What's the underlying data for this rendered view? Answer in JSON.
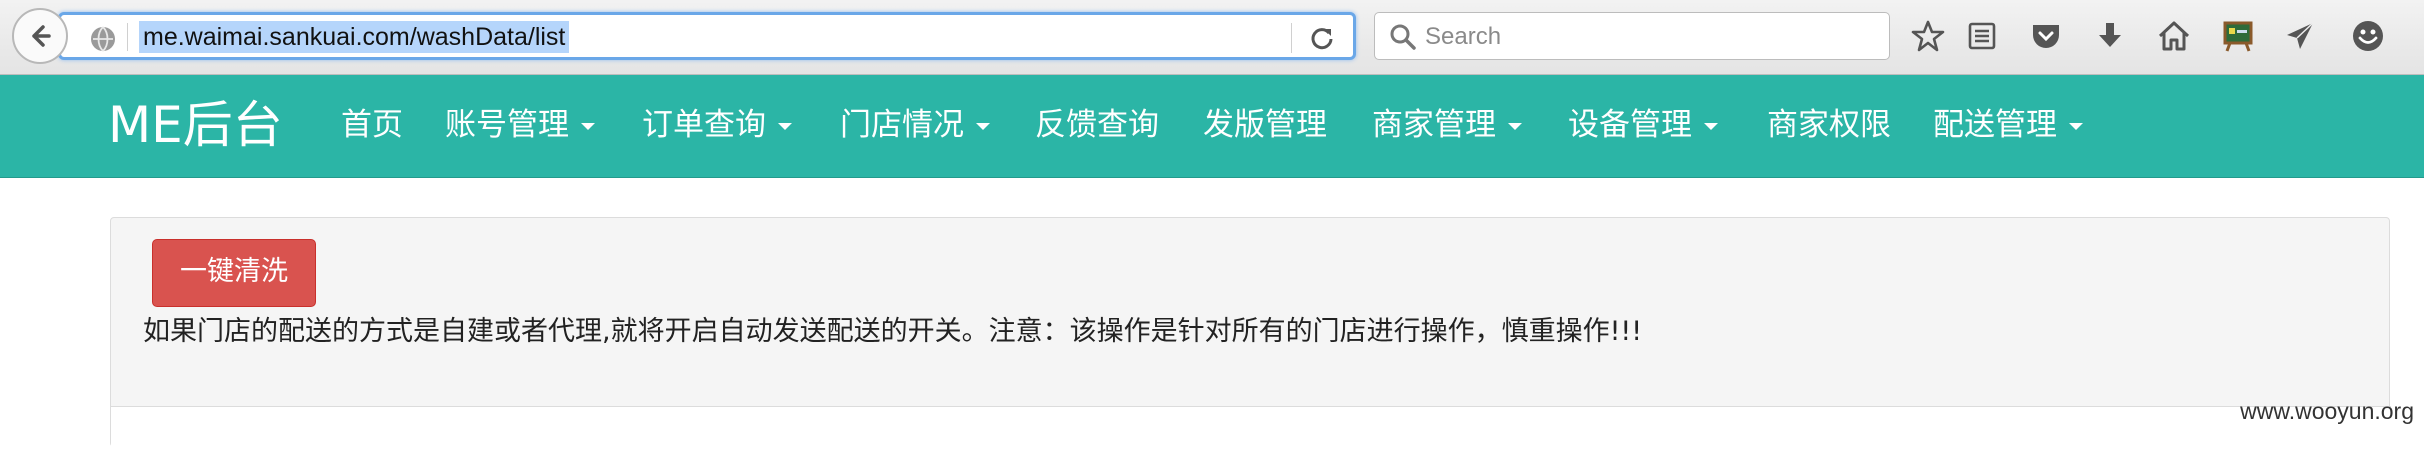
{
  "browser": {
    "url": "me.waimai.sankuai.com/washData/list",
    "search_placeholder": "Search"
  },
  "navbar": {
    "brand": "ME后台",
    "items": [
      {
        "label": "首页",
        "dropdown": false
      },
      {
        "label": "账号管理",
        "dropdown": true
      },
      {
        "label": "订单查询",
        "dropdown": true
      },
      {
        "label": "门店情况",
        "dropdown": true
      },
      {
        "label": "反馈查询",
        "dropdown": false
      },
      {
        "label": "发版管理",
        "dropdown": false
      },
      {
        "label": "商家管理",
        "dropdown": true
      },
      {
        "label": "设备管理",
        "dropdown": true
      },
      {
        "label": "商家权限",
        "dropdown": false
      },
      {
        "label": "配送管理",
        "dropdown": true
      }
    ]
  },
  "panel": {
    "button_label": "一键清洗",
    "notice": "如果门店的配送的方式是自建或者代理,就将开启自动发送配送的开关。注意：该操作是针对所有的门店进行操作，慎重操作!!!"
  },
  "watermark": "www.wooyun.org",
  "colors": {
    "navbar": "#2bb5a6",
    "danger_button": "#d9534f"
  }
}
